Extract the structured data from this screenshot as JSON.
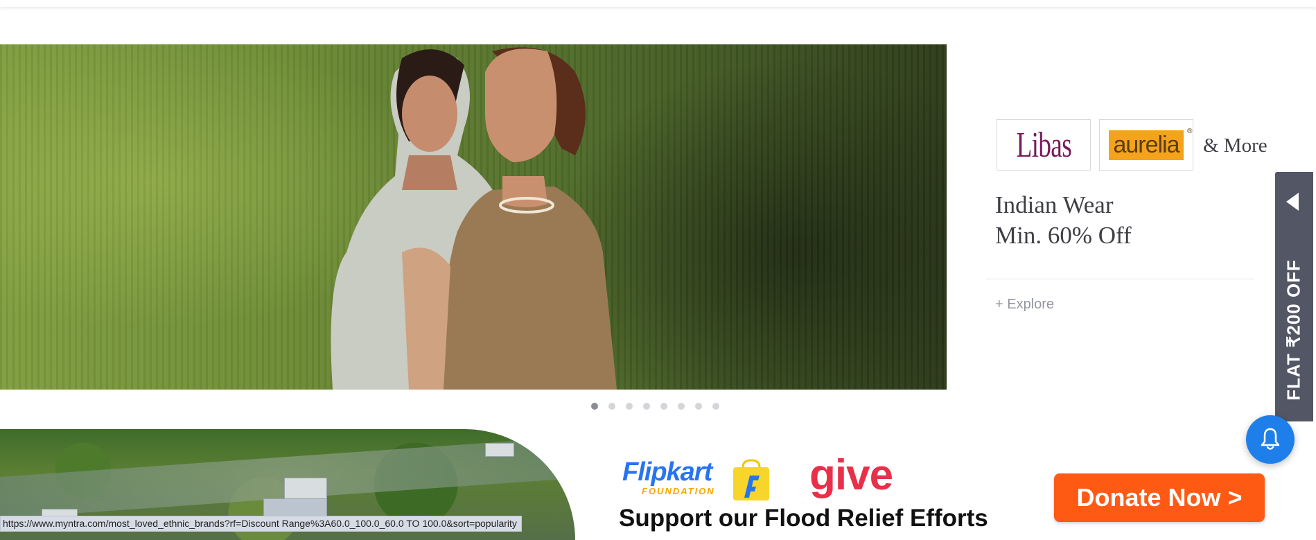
{
  "promo": {
    "brands": [
      "Libas",
      "aurelia"
    ],
    "more_label": "& More",
    "title_line1": "Indian Wear",
    "title_line2": "Min. 60% Off",
    "explore_label": "+ Explore"
  },
  "side_tab": {
    "label": "FLAT ₹200 OFF"
  },
  "carousel": {
    "total_dots": 8,
    "active_index": 0
  },
  "flood_banner": {
    "brand_main": "Flipkart",
    "brand_sub": "FOUNDATION",
    "give_label": "give",
    "headline": "Support our Flood Relief Efforts",
    "donate_label": "Donate Now >"
  },
  "status_bar": {
    "url": "https://www.myntra.com/most_loved_ethnic_brands?rf=Discount Range%3A60.0_100.0_60.0 TO 100.0&sort=popularity"
  },
  "colors": {
    "accent_blue": "#1f7fea",
    "donate_orange": "#fe5a14",
    "side_tab_bg": "#535665",
    "give_red": "#e8304a"
  },
  "icons": {
    "bell": "bell-icon",
    "side_arrow": "chevron-left-icon"
  }
}
